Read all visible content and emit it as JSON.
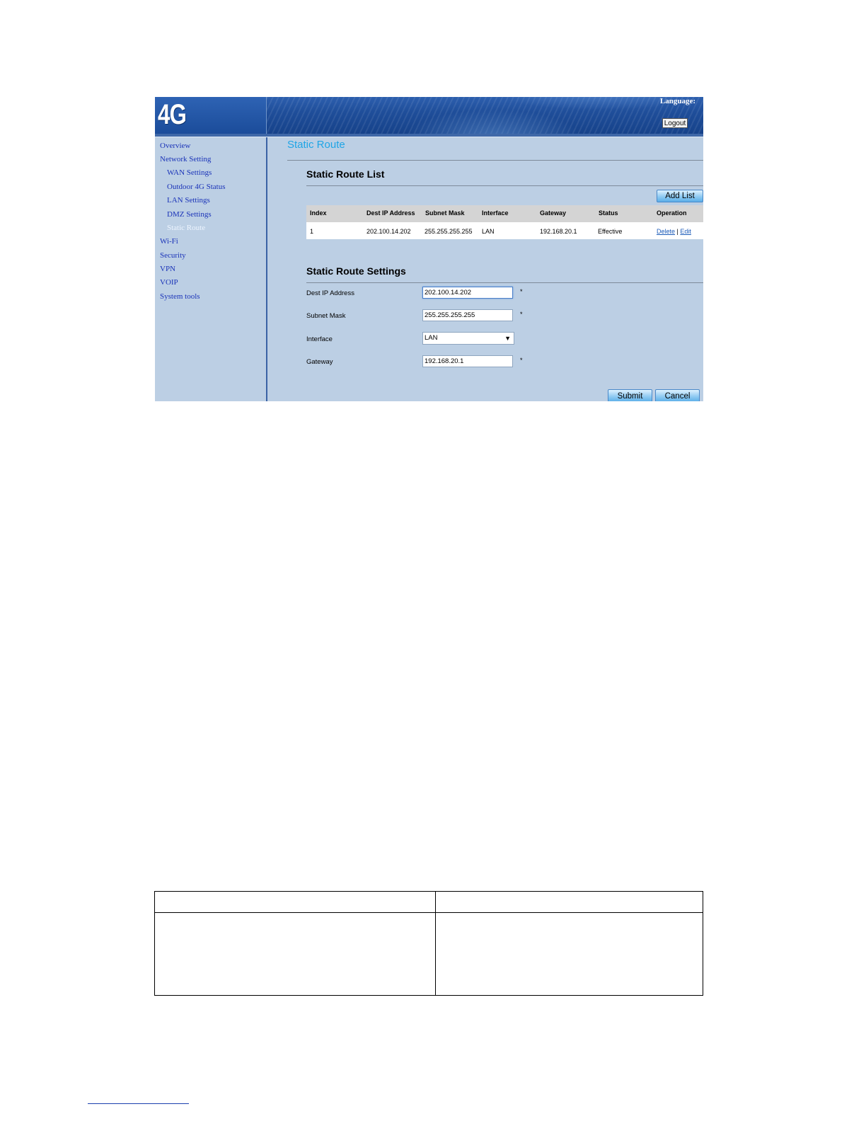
{
  "header": {
    "logo": "4G Router",
    "language_label": "Language:",
    "logout_label": "Logout"
  },
  "sidebar": {
    "items": [
      {
        "label": "Overview"
      },
      {
        "label": "Network Setting"
      },
      {
        "label": "WAN Settings"
      },
      {
        "label": "Outdoor 4G Status"
      },
      {
        "label": "LAN Settings"
      },
      {
        "label": "DMZ Settings"
      },
      {
        "label": "Static Route",
        "active": true
      },
      {
        "label": "Wi-Fi"
      },
      {
        "label": "Security"
      },
      {
        "label": "VPN"
      },
      {
        "label": "VOIP"
      },
      {
        "label": "System tools"
      }
    ]
  },
  "main": {
    "page_title": "Static Route",
    "list_title": "Static Route List",
    "add_list_label": "Add List",
    "table": {
      "columns": [
        "Index",
        "Dest IP Address",
        "Subnet Mask",
        "Interface",
        "Gateway",
        "Status",
        "Operation"
      ],
      "rows": [
        {
          "index": "1",
          "dest_ip": "202.100.14.202",
          "subnet_mask": "255.255.255.255",
          "interface": "LAN",
          "gateway": "192.168.20.1",
          "status": "Effective",
          "delete_label": "Delete",
          "separator": "|",
          "edit_label": "Edit"
        }
      ]
    },
    "settings_title": "Static Route Settings",
    "form": {
      "dest_ip_label": "Dest IP Address",
      "dest_ip_value": "202.100.14.202",
      "subnet_label": "Subnet Mask",
      "subnet_value": "255.255.255.255",
      "interface_label": "Interface",
      "interface_value": "LAN",
      "gateway_label": "Gateway",
      "gateway_value": "192.168.20.1",
      "required_mark": "*"
    },
    "submit_label": "Submit",
    "cancel_label": "Cancel"
  },
  "colors": {
    "page_bg": "#bccfe4",
    "header_bg": "#1f4e9a",
    "title_accent": "#1ea5e6",
    "nav_link": "#1a33b8"
  }
}
